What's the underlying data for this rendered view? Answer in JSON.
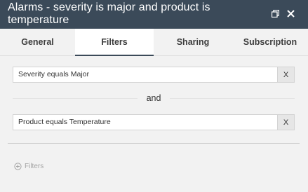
{
  "window": {
    "title": "Alarms - severity is major and product is temperature",
    "restore_icon": "restore-window-icon",
    "close_icon": "close-icon"
  },
  "tabs": [
    {
      "label": "General",
      "active": false
    },
    {
      "label": "Filters",
      "active": true
    },
    {
      "label": "Sharing",
      "active": false
    },
    {
      "label": "Subscription",
      "active": false
    }
  ],
  "filters": [
    {
      "text": "Severity equals Major",
      "remove_label": "X"
    },
    {
      "text": "Product equals Temperature",
      "remove_label": "X"
    }
  ],
  "join_label": "and",
  "add_filter": {
    "label": "Filters",
    "icon": "add-circle-icon"
  },
  "colors": {
    "titlebar": "#3b4a59",
    "background": "#f2f2f2",
    "active_tab": "#ffffff"
  }
}
